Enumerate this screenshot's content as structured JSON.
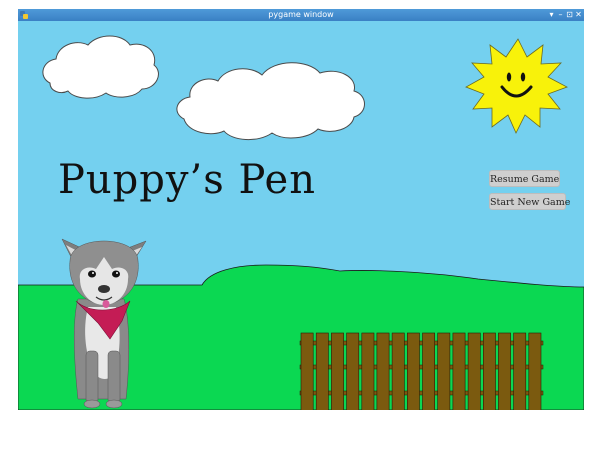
{
  "window": {
    "title": "pygame window",
    "controls": {
      "menu": "▾",
      "minimize": "–",
      "maximize": "⊡",
      "close": "✕"
    }
  },
  "game": {
    "title": "Puppy’s Pen",
    "menu": {
      "resume_label": "Resume Game",
      "new_game_label": "Start New Game"
    }
  },
  "colors": {
    "sky": "#74d0ef",
    "grass": "#0bd852",
    "sun": "#f8f20a",
    "fence": "#7b5a0f",
    "button": "#cfcfcf"
  },
  "icons": {
    "app": "python-icon"
  }
}
